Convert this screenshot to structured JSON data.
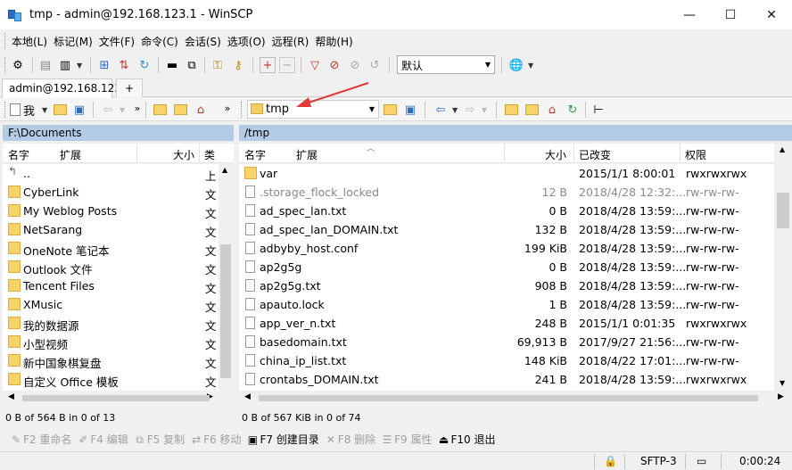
{
  "window": {
    "title": "tmp - admin@192.168.123.1 - WinSCP",
    "minimize": "—",
    "maximize": "☐",
    "close": "✕"
  },
  "menu": [
    "本地(L)",
    "标记(M)",
    "文件(F)",
    "命令(C)",
    "会话(S)",
    "选项(O)",
    "远程(R)",
    "帮助(H)"
  ],
  "toolbar": {
    "transfer_profile": "默认"
  },
  "tabs": {
    "active": "admin@192.168.123.1",
    "new_tab": "+"
  },
  "left_toolbar": {
    "drive_label": "我"
  },
  "right_toolbar": {
    "path": "tmp"
  },
  "left_panel": {
    "path": "F:\\Documents",
    "columns": [
      "名字",
      "扩展",
      "大小",
      "类"
    ],
    "rows": [
      {
        "name": "..",
        "type": "上",
        "icon": "up-folder"
      },
      {
        "name": "CyberLink",
        "type": "文",
        "icon": "folder"
      },
      {
        "name": "My Weblog Posts",
        "type": "文",
        "icon": "folder"
      },
      {
        "name": "NetSarang",
        "type": "文",
        "icon": "folder"
      },
      {
        "name": "OneNote 笔记本",
        "type": "文",
        "icon": "folder"
      },
      {
        "name": "Outlook 文件",
        "type": "文",
        "icon": "folder"
      },
      {
        "name": "Tencent Files",
        "type": "文",
        "icon": "folder"
      },
      {
        "name": "XMusic",
        "type": "文",
        "icon": "folder"
      },
      {
        "name": "我的数据源",
        "type": "文",
        "icon": "special-folder"
      },
      {
        "name": "小型视频",
        "type": "文",
        "icon": "folder"
      },
      {
        "name": "新中国象棋复盘",
        "type": "文",
        "icon": "folder"
      },
      {
        "name": "自定义 Office 模板",
        "type": "文",
        "icon": "folder"
      }
    ],
    "status": "0 B of 564 B in 0 of 13"
  },
  "right_panel": {
    "path": "/tmp",
    "columns": [
      "名字",
      "扩展",
      "大小",
      "已改变",
      "权限"
    ],
    "rows": [
      {
        "name": "var",
        "size": "",
        "changed": "2015/1/1 8:00:01",
        "rights": "rwxrwxrwx",
        "icon": "folder",
        "dim": false
      },
      {
        "name": ".storage_flock_locked",
        "size": "12 B",
        "changed": "2018/4/28 12:32:...",
        "rights": "rw-rw-rw-",
        "icon": "file",
        "dim": true
      },
      {
        "name": "ad_spec_lan.txt",
        "size": "0 B",
        "changed": "2018/4/28 13:59:...",
        "rights": "rw-rw-rw-",
        "icon": "file",
        "dim": false
      },
      {
        "name": "ad_spec_lan_DOMAIN.txt",
        "size": "132 B",
        "changed": "2018/4/28 13:59:...",
        "rights": "rw-rw-rw-",
        "icon": "file",
        "dim": false
      },
      {
        "name": "adbyby_host.conf",
        "size": "199 KiB",
        "changed": "2018/4/28 13:59:...",
        "rights": "rw-rw-rw-",
        "icon": "file",
        "dim": false
      },
      {
        "name": "ap2g5g",
        "size": "0 B",
        "changed": "2018/4/28 13:59:...",
        "rights": "rw-rw-rw-",
        "icon": "file",
        "dim": false
      },
      {
        "name": "ap2g5g.txt",
        "size": "908 B",
        "changed": "2018/4/28 13:59:...",
        "rights": "rw-rw-rw-",
        "icon": "file",
        "dim": false
      },
      {
        "name": "apauto.lock",
        "size": "1 B",
        "changed": "2018/4/28 13:59:...",
        "rights": "rw-rw-rw-",
        "icon": "file",
        "dim": false
      },
      {
        "name": "app_ver_n.txt",
        "size": "248 B",
        "changed": "2015/1/1 0:01:35",
        "rights": "rwxrwxrwx",
        "icon": "file",
        "dim": false
      },
      {
        "name": "basedomain.txt",
        "size": "69,913 B",
        "changed": "2017/9/27 21:56:...",
        "rights": "rw-rw-rw-",
        "icon": "file",
        "dim": false
      },
      {
        "name": "china_ip_list.txt",
        "size": "148 KiB",
        "changed": "2018/4/22 17:01:...",
        "rights": "rw-rw-rw-",
        "icon": "file",
        "dim": false
      },
      {
        "name": "crontabs_DOMAIN.txt",
        "size": "241 B",
        "changed": "2018/4/28 13:59:...",
        "rights": "rwxrwxrwx",
        "icon": "file",
        "dim": false
      }
    ],
    "status": "0 B of 567 KiB in 0 of 74"
  },
  "fkeys": [
    {
      "label": "F2 重命名",
      "icon": "rename-icon",
      "glyph": "✎",
      "enabled": false
    },
    {
      "label": "F4 编辑",
      "icon": "edit-icon",
      "glyph": "✐",
      "enabled": false
    },
    {
      "label": "F5 复制",
      "icon": "copy-icon",
      "glyph": "⧉",
      "enabled": false
    },
    {
      "label": "F6 移动",
      "icon": "move-icon",
      "glyph": "⇄",
      "enabled": false
    },
    {
      "label": "F7 创建目录",
      "icon": "new-folder-icon",
      "glyph": "▣",
      "enabled": true
    },
    {
      "label": "F8 删除",
      "icon": "delete-icon",
      "glyph": "✕",
      "enabled": false
    },
    {
      "label": "F9 属性",
      "icon": "properties-icon",
      "glyph": "☰",
      "enabled": false
    },
    {
      "label": "F10 退出",
      "icon": "exit-icon",
      "glyph": "⏏",
      "enabled": true
    }
  ],
  "statusbar": {
    "protocol": "SFTP-3",
    "elapsed": "0:00:24"
  },
  "colors": {
    "panel_header": "#b3cbe4",
    "folder": "#f8d36a",
    "annotation_arrow": "#e03a3a"
  }
}
